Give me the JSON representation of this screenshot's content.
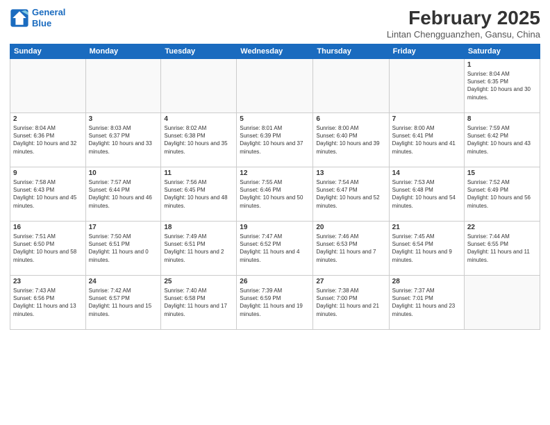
{
  "logo": {
    "line1": "General",
    "line2": "Blue"
  },
  "title": "February 2025",
  "subtitle": "Lintan Chengguanzhen, Gansu, China",
  "headers": [
    "Sunday",
    "Monday",
    "Tuesday",
    "Wednesday",
    "Thursday",
    "Friday",
    "Saturday"
  ],
  "weeks": [
    [
      {
        "day": "",
        "info": ""
      },
      {
        "day": "",
        "info": ""
      },
      {
        "day": "",
        "info": ""
      },
      {
        "day": "",
        "info": ""
      },
      {
        "day": "",
        "info": ""
      },
      {
        "day": "",
        "info": ""
      },
      {
        "day": "1",
        "info": "Sunrise: 8:04 AM\nSunset: 6:35 PM\nDaylight: 10 hours and 30 minutes."
      }
    ],
    [
      {
        "day": "2",
        "info": "Sunrise: 8:04 AM\nSunset: 6:36 PM\nDaylight: 10 hours and 32 minutes."
      },
      {
        "day": "3",
        "info": "Sunrise: 8:03 AM\nSunset: 6:37 PM\nDaylight: 10 hours and 33 minutes."
      },
      {
        "day": "4",
        "info": "Sunrise: 8:02 AM\nSunset: 6:38 PM\nDaylight: 10 hours and 35 minutes."
      },
      {
        "day": "5",
        "info": "Sunrise: 8:01 AM\nSunset: 6:39 PM\nDaylight: 10 hours and 37 minutes."
      },
      {
        "day": "6",
        "info": "Sunrise: 8:00 AM\nSunset: 6:40 PM\nDaylight: 10 hours and 39 minutes."
      },
      {
        "day": "7",
        "info": "Sunrise: 8:00 AM\nSunset: 6:41 PM\nDaylight: 10 hours and 41 minutes."
      },
      {
        "day": "8",
        "info": "Sunrise: 7:59 AM\nSunset: 6:42 PM\nDaylight: 10 hours and 43 minutes."
      }
    ],
    [
      {
        "day": "9",
        "info": "Sunrise: 7:58 AM\nSunset: 6:43 PM\nDaylight: 10 hours and 45 minutes."
      },
      {
        "day": "10",
        "info": "Sunrise: 7:57 AM\nSunset: 6:44 PM\nDaylight: 10 hours and 46 minutes."
      },
      {
        "day": "11",
        "info": "Sunrise: 7:56 AM\nSunset: 6:45 PM\nDaylight: 10 hours and 48 minutes."
      },
      {
        "day": "12",
        "info": "Sunrise: 7:55 AM\nSunset: 6:46 PM\nDaylight: 10 hours and 50 minutes."
      },
      {
        "day": "13",
        "info": "Sunrise: 7:54 AM\nSunset: 6:47 PM\nDaylight: 10 hours and 52 minutes."
      },
      {
        "day": "14",
        "info": "Sunrise: 7:53 AM\nSunset: 6:48 PM\nDaylight: 10 hours and 54 minutes."
      },
      {
        "day": "15",
        "info": "Sunrise: 7:52 AM\nSunset: 6:49 PM\nDaylight: 10 hours and 56 minutes."
      }
    ],
    [
      {
        "day": "16",
        "info": "Sunrise: 7:51 AM\nSunset: 6:50 PM\nDaylight: 10 hours and 58 minutes."
      },
      {
        "day": "17",
        "info": "Sunrise: 7:50 AM\nSunset: 6:51 PM\nDaylight: 11 hours and 0 minutes."
      },
      {
        "day": "18",
        "info": "Sunrise: 7:49 AM\nSunset: 6:51 PM\nDaylight: 11 hours and 2 minutes."
      },
      {
        "day": "19",
        "info": "Sunrise: 7:47 AM\nSunset: 6:52 PM\nDaylight: 11 hours and 4 minutes."
      },
      {
        "day": "20",
        "info": "Sunrise: 7:46 AM\nSunset: 6:53 PM\nDaylight: 11 hours and 7 minutes."
      },
      {
        "day": "21",
        "info": "Sunrise: 7:45 AM\nSunset: 6:54 PM\nDaylight: 11 hours and 9 minutes."
      },
      {
        "day": "22",
        "info": "Sunrise: 7:44 AM\nSunset: 6:55 PM\nDaylight: 11 hours and 11 minutes."
      }
    ],
    [
      {
        "day": "23",
        "info": "Sunrise: 7:43 AM\nSunset: 6:56 PM\nDaylight: 11 hours and 13 minutes."
      },
      {
        "day": "24",
        "info": "Sunrise: 7:42 AM\nSunset: 6:57 PM\nDaylight: 11 hours and 15 minutes."
      },
      {
        "day": "25",
        "info": "Sunrise: 7:40 AM\nSunset: 6:58 PM\nDaylight: 11 hours and 17 minutes."
      },
      {
        "day": "26",
        "info": "Sunrise: 7:39 AM\nSunset: 6:59 PM\nDaylight: 11 hours and 19 minutes."
      },
      {
        "day": "27",
        "info": "Sunrise: 7:38 AM\nSunset: 7:00 PM\nDaylight: 11 hours and 21 minutes."
      },
      {
        "day": "28",
        "info": "Sunrise: 7:37 AM\nSunset: 7:01 PM\nDaylight: 11 hours and 23 minutes."
      },
      {
        "day": "",
        "info": ""
      }
    ]
  ]
}
